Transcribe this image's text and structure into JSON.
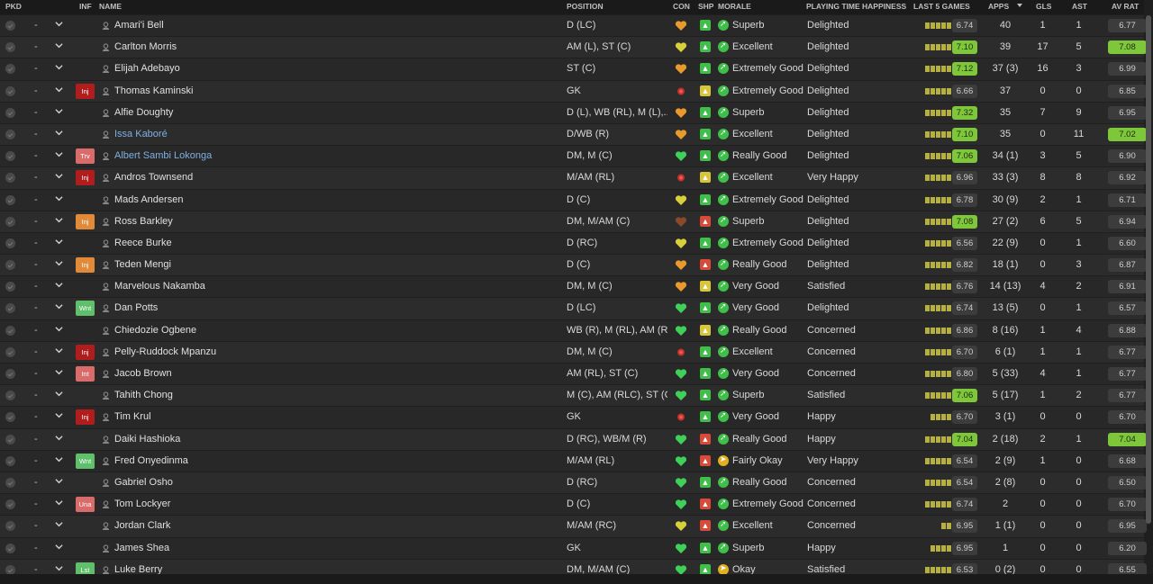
{
  "columns": {
    "pkd": "PKD",
    "inf": "INF",
    "name": "NAME",
    "position": "POSITION",
    "con": "CON",
    "ship": "SHP",
    "morale": "MORALE",
    "pth": "PLAYING TIME HAPPINESS",
    "last5": "LAST 5 GAMES",
    "apps": "APPS",
    "gls": "GLS",
    "ast": "AST",
    "avrat": "AV RAT"
  },
  "colors": {
    "accent_green": "#7ec63a",
    "link_blue": "#7fb0e0",
    "injury_red": "#b11d1d"
  },
  "players": [
    {
      "name": "Amari'i Bell",
      "position": "D (LC)",
      "morale": "Superb",
      "pth": "Delighted",
      "last5_rating": "6.74",
      "apps": "40",
      "gls": "1",
      "ast": "1",
      "avrat": "6.77",
      "dash": "-",
      "inf": "",
      "con": "orange",
      "ship": "green",
      "mor": "up",
      "bars": [
        1,
        1,
        1,
        1,
        1
      ],
      "hi_rate": false,
      "hi_av": false,
      "link": false
    },
    {
      "name": "Carlton Morris",
      "position": "AM (L), ST (C)",
      "morale": "Excellent",
      "pth": "Delighted",
      "last5_rating": "7.10",
      "apps": "39",
      "gls": "17",
      "ast": "5",
      "avrat": "7.08",
      "dash": "-",
      "inf": "",
      "con": "yellow",
      "ship": "green",
      "mor": "up",
      "bars": [
        1,
        1,
        1,
        1,
        1
      ],
      "hi_rate": true,
      "hi_av": true,
      "link": false
    },
    {
      "name": "Elijah Adebayo",
      "position": "ST (C)",
      "morale": "Extremely Good",
      "pth": "Delighted",
      "last5_rating": "7.12",
      "apps": "37 (3)",
      "gls": "16",
      "ast": "3",
      "avrat": "6.99",
      "dash": "-",
      "inf": "",
      "con": "orange",
      "ship": "green",
      "mor": "up",
      "bars": [
        1,
        1,
        1,
        1,
        1
      ],
      "hi_rate": true,
      "hi_av": false,
      "link": false
    },
    {
      "name": "Thomas Kaminski",
      "position": "GK",
      "morale": "Extremely Good",
      "pth": "Delighted",
      "last5_rating": "6.66",
      "apps": "37",
      "gls": "0",
      "ast": "0",
      "avrat": "6.85",
      "dash": "-",
      "inf": "Inj",
      "con": "injured",
      "ship": "yellow",
      "mor": "up",
      "bars": [
        1,
        1,
        1,
        1,
        1
      ],
      "hi_rate": false,
      "hi_av": false,
      "link": false
    },
    {
      "name": "Alfie Doughty",
      "position": "D (L), WB (RL), M (L),...",
      "morale": "Superb",
      "pth": "Delighted",
      "last5_rating": "7.32",
      "apps": "35",
      "gls": "7",
      "ast": "9",
      "avrat": "6.95",
      "dash": "-",
      "inf": "",
      "con": "orange",
      "ship": "green",
      "mor": "up",
      "bars": [
        1,
        1,
        1,
        1,
        1
      ],
      "hi_rate": true,
      "hi_av": false,
      "link": false
    },
    {
      "name": "Issa Kaboré",
      "position": "D/WB (R)",
      "morale": "Excellent",
      "pth": "Delighted",
      "last5_rating": "7.10",
      "apps": "35",
      "gls": "0",
      "ast": "11",
      "avrat": "7.02",
      "dash": "-",
      "inf": "",
      "con": "orange",
      "ship": "green",
      "mor": "up",
      "bars": [
        1,
        1,
        1,
        1,
        1
      ],
      "hi_rate": true,
      "hi_av": true,
      "link": true
    },
    {
      "name": "Albert Sambi Lokonga",
      "position": "DM, M (C)",
      "morale": "Really Good",
      "pth": "Delighted",
      "last5_rating": "7.06",
      "apps": "34 (1)",
      "gls": "3",
      "ast": "5",
      "avrat": "6.90",
      "dash": "-",
      "inf": "Trv",
      "con": "green",
      "ship": "green",
      "mor": "up",
      "bars": [
        1,
        1,
        1,
        1,
        1
      ],
      "hi_rate": true,
      "hi_av": false,
      "link": true
    },
    {
      "name": "Andros Townsend",
      "position": "M/AM (RL)",
      "morale": "Excellent",
      "pth": "Very Happy",
      "last5_rating": "6.96",
      "apps": "33 (3)",
      "gls": "8",
      "ast": "8",
      "avrat": "6.92",
      "dash": "-",
      "inf": "Inj",
      "con": "injured",
      "ship": "yellow",
      "mor": "up",
      "bars": [
        1,
        1,
        1,
        1,
        1
      ],
      "hi_rate": false,
      "hi_av": false,
      "link": false
    },
    {
      "name": "Mads Andersen",
      "position": "D (C)",
      "morale": "Extremely Good",
      "pth": "Delighted",
      "last5_rating": "6.78",
      "apps": "30 (9)",
      "gls": "2",
      "ast": "1",
      "avrat": "6.71",
      "dash": "-",
      "inf": "",
      "con": "yellow",
      "ship": "green",
      "mor": "up",
      "bars": [
        1,
        1,
        1,
        1,
        1
      ],
      "hi_rate": false,
      "hi_av": false,
      "link": false
    },
    {
      "name": "Ross Barkley",
      "position": "DM, M/AM (C)",
      "morale": "Superb",
      "pth": "Delighted",
      "last5_rating": "7.08",
      "apps": "27 (2)",
      "gls": "6",
      "ast": "5",
      "avrat": "6.94",
      "dash": "-",
      "inf": "Inj",
      "con": "dark",
      "ship": "red",
      "mor": "up",
      "bars": [
        1,
        1,
        1,
        1,
        1
      ],
      "hi_rate": true,
      "hi_av": false,
      "link": false
    },
    {
      "name": "Reece Burke",
      "position": "D (RC)",
      "morale": "Extremely Good",
      "pth": "Delighted",
      "last5_rating": "6.56",
      "apps": "22 (9)",
      "gls": "0",
      "ast": "1",
      "avrat": "6.60",
      "dash": "-",
      "inf": "",
      "con": "yellow",
      "ship": "green",
      "mor": "up",
      "bars": [
        1,
        1,
        1,
        1,
        1
      ],
      "hi_rate": false,
      "hi_av": false,
      "link": false
    },
    {
      "name": "Teden Mengi",
      "position": "D (C)",
      "morale": "Really Good",
      "pth": "Delighted",
      "last5_rating": "6.82",
      "apps": "18 (1)",
      "gls": "0",
      "ast": "3",
      "avrat": "6.87",
      "dash": "-",
      "inf": "Inj",
      "con": "orange",
      "ship": "red",
      "mor": "up",
      "bars": [
        1,
        1,
        1,
        1,
        1
      ],
      "hi_rate": false,
      "hi_av": false,
      "link": false
    },
    {
      "name": "Marvelous Nakamba",
      "position": "DM, M (C)",
      "morale": "Very Good",
      "pth": "Satisfied",
      "last5_rating": "6.76",
      "apps": "14 (13)",
      "gls": "4",
      "ast": "2",
      "avrat": "6.91",
      "dash": "-",
      "inf": "",
      "con": "orange",
      "ship": "yellow",
      "mor": "up",
      "bars": [
        1,
        1,
        1,
        1,
        1
      ],
      "hi_rate": false,
      "hi_av": false,
      "link": false
    },
    {
      "name": "Dan Potts",
      "position": "D (LC)",
      "morale": "Very Good",
      "pth": "Delighted",
      "last5_rating": "6.74",
      "apps": "13 (5)",
      "gls": "0",
      "ast": "1",
      "avrat": "6.57",
      "dash": "-",
      "inf": "Wnt",
      "con": "green",
      "ship": "green",
      "mor": "up",
      "bars": [
        1,
        1,
        1,
        1,
        1
      ],
      "hi_rate": false,
      "hi_av": false,
      "link": false
    },
    {
      "name": "Chiedozie Ogbene",
      "position": "WB (R), M (RL), AM (RL)",
      "morale": "Really Good",
      "pth": "Concerned",
      "last5_rating": "6.86",
      "apps": "8 (16)",
      "gls": "1",
      "ast": "4",
      "avrat": "6.88",
      "dash": "-",
      "inf": "",
      "con": "green",
      "ship": "yellow",
      "mor": "up",
      "bars": [
        1,
        1,
        1,
        1,
        1
      ],
      "hi_rate": false,
      "hi_av": false,
      "link": false
    },
    {
      "name": "Pelly-Ruddock Mpanzu",
      "position": "DM, M (C)",
      "morale": "Excellent",
      "pth": "Concerned",
      "last5_rating": "6.70",
      "apps": "6 (1)",
      "gls": "1",
      "ast": "1",
      "avrat": "6.77",
      "dash": "-",
      "inf": "Inj",
      "con": "injured",
      "ship": "green",
      "mor": "up",
      "bars": [
        1,
        1,
        1,
        1,
        1
      ],
      "hi_rate": false,
      "hi_av": false,
      "link": false
    },
    {
      "name": "Jacob Brown",
      "position": "AM (RL), ST (C)",
      "morale": "Very Good",
      "pth": "Concerned",
      "last5_rating": "6.80",
      "apps": "5 (33)",
      "gls": "4",
      "ast": "1",
      "avrat": "6.77",
      "dash": "-",
      "inf": "Int",
      "con": "green",
      "ship": "green",
      "mor": "up",
      "bars": [
        1,
        1,
        1,
        1,
        1
      ],
      "hi_rate": false,
      "hi_av": false,
      "link": false
    },
    {
      "name": "Tahith Chong",
      "position": "M (C), AM (RLC), ST (C)",
      "morale": "Superb",
      "pth": "Satisfied",
      "last5_rating": "7.06",
      "apps": "5 (17)",
      "gls": "1",
      "ast": "2",
      "avrat": "6.77",
      "dash": "-",
      "inf": "",
      "con": "green",
      "ship": "green",
      "mor": "up",
      "bars": [
        1,
        1,
        1,
        1,
        1
      ],
      "hi_rate": true,
      "hi_av": false,
      "link": false
    },
    {
      "name": "Tim Krul",
      "position": "GK",
      "morale": "Very Good",
      "pth": "Happy",
      "last5_rating": "6.70",
      "apps": "3 (1)",
      "gls": "0",
      "ast": "0",
      "avrat": "6.70",
      "dash": "-",
      "inf": "Inj",
      "con": "injured",
      "ship": "green",
      "mor": "up",
      "bars": [
        1,
        1,
        1,
        1
      ],
      "hi_rate": false,
      "hi_av": false,
      "link": false
    },
    {
      "name": "Daiki Hashioka",
      "position": "D (RC), WB/M (R)",
      "morale": "Really Good",
      "pth": "Happy",
      "last5_rating": "7.04",
      "apps": "2 (18)",
      "gls": "2",
      "ast": "1",
      "avrat": "7.04",
      "dash": "-",
      "inf": "",
      "con": "green",
      "ship": "red",
      "mor": "up",
      "bars": [
        1,
        1,
        1,
        1,
        1
      ],
      "hi_rate": true,
      "hi_av": true,
      "link": false
    },
    {
      "name": "Fred Onyedinma",
      "position": "M/AM (RL)",
      "morale": "Fairly Okay",
      "pth": "Very Happy",
      "last5_rating": "6.54",
      "apps": "2 (9)",
      "gls": "1",
      "ast": "0",
      "avrat": "6.68",
      "dash": "-",
      "inf": "Wnt",
      "con": "green",
      "ship": "red",
      "mor": "neutral",
      "bars": [
        1,
        1,
        1,
        1,
        1
      ],
      "hi_rate": false,
      "hi_av": false,
      "link": false
    },
    {
      "name": "Gabriel Osho",
      "position": "D (RC)",
      "morale": "Really Good",
      "pth": "Concerned",
      "last5_rating": "6.54",
      "apps": "2 (8)",
      "gls": "0",
      "ast": "0",
      "avrat": "6.50",
      "dash": "-",
      "inf": "",
      "con": "green",
      "ship": "green",
      "mor": "up",
      "bars": [
        1,
        1,
        1,
        1,
        1
      ],
      "hi_rate": false,
      "hi_av": false,
      "link": false
    },
    {
      "name": "Tom Lockyer",
      "position": "D (C)",
      "morale": "Extremely Good",
      "pth": "Concerned",
      "last5_rating": "6.74",
      "apps": "2",
      "gls": "0",
      "ast": "0",
      "avrat": "6.70",
      "dash": "-",
      "inf": "Una",
      "con": "green",
      "ship": "red",
      "mor": "up",
      "bars": [
        1,
        1,
        1,
        1,
        1
      ],
      "hi_rate": false,
      "hi_av": false,
      "link": false
    },
    {
      "name": "Jordan Clark",
      "position": "M/AM (RC)",
      "morale": "Excellent",
      "pth": "Concerned",
      "last5_rating": "6.95",
      "apps": "1 (1)",
      "gls": "0",
      "ast": "0",
      "avrat": "6.95",
      "dash": "-",
      "inf": "",
      "con": "yellow",
      "ship": "red",
      "mor": "up",
      "bars": [
        1,
        1
      ],
      "hi_rate": false,
      "hi_av": false,
      "link": false
    },
    {
      "name": "James Shea",
      "position": "GK",
      "morale": "Superb",
      "pth": "Happy",
      "last5_rating": "6.95",
      "apps": "1",
      "gls": "0",
      "ast": "0",
      "avrat": "6.20",
      "dash": "-",
      "inf": "",
      "con": "green",
      "ship": "green",
      "mor": "up",
      "bars": [
        1,
        1,
        1,
        1
      ],
      "hi_rate": false,
      "hi_av": false,
      "link": false
    },
    {
      "name": "Luke Berry",
      "position": "DM, M/AM (C)",
      "morale": "Okay",
      "pth": "Satisfied",
      "last5_rating": "6.53",
      "apps": "0 (2)",
      "gls": "0",
      "ast": "0",
      "avrat": "6.55",
      "dash": "-",
      "inf": "Lst",
      "con": "green",
      "ship": "green",
      "mor": "neutral",
      "bars": [
        1,
        1,
        1,
        1,
        1
      ],
      "hi_rate": false,
      "hi_av": false,
      "link": false
    }
  ]
}
